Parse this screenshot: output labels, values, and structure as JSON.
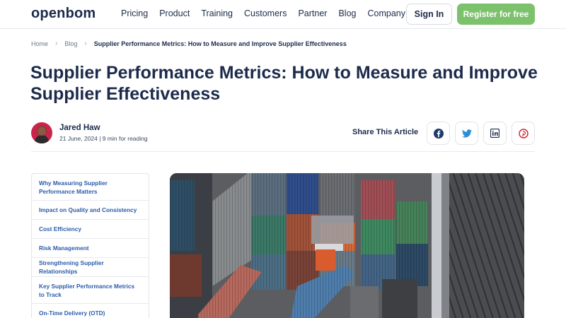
{
  "brand": {
    "logo_text": "openbom"
  },
  "nav": {
    "items": [
      "Pricing",
      "Product",
      "Training",
      "Customers",
      "Partner",
      "Blog",
      "Company"
    ],
    "signin_label": "Sign In",
    "register_label": "Register for free"
  },
  "breadcrumb": {
    "home": "Home",
    "blog": "Blog",
    "current": "Supplier Performance Metrics: How to Measure and Improve Supplier Effectiveness"
  },
  "article": {
    "title": "Supplier Performance Metrics: How to Measure and Improve Supplier Effectiveness",
    "author": "Jared Haw",
    "meta": "21 June, 2024 | 9 min for reading",
    "share_label": "Share This Article"
  },
  "share": {
    "icons": [
      "facebook-icon",
      "twitter-icon",
      "linkedin-icon",
      "pinterest-icon"
    ]
  },
  "toc": {
    "items": [
      "Why Measuring Supplier Performance Matters",
      "Impact on Quality and Consistency",
      "Cost Efficiency",
      "Risk Management",
      "Strengthening Supplier Relationships",
      "Key Supplier Performance Metrics to Track",
      "On-Time Delivery (OTD)"
    ]
  },
  "colors": {
    "accent_green": "#7cc16b",
    "link_blue": "#2b5cab",
    "navy": "#1c2b4b"
  }
}
